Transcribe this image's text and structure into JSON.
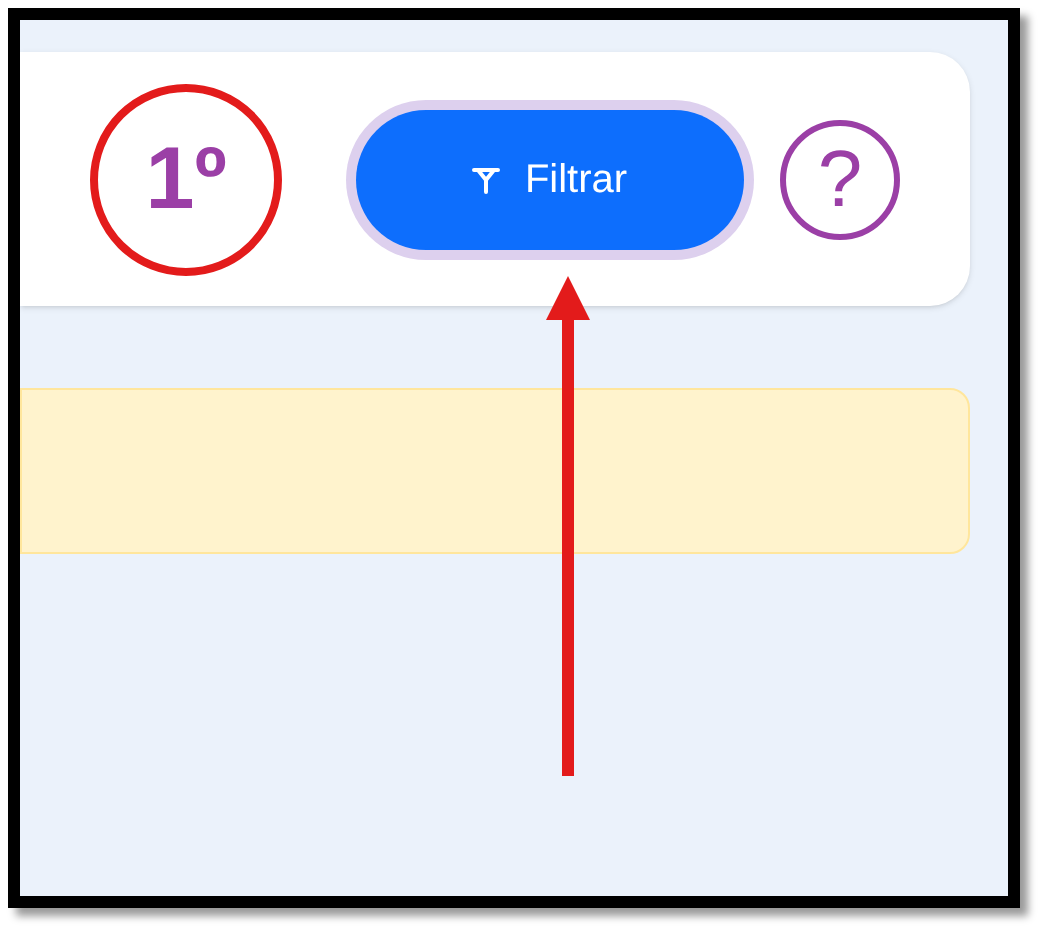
{
  "annotation": {
    "step": "1º"
  },
  "header": {
    "filter_button": {
      "label": "Filtrar"
    },
    "help_button": {
      "label": "?"
    }
  }
}
